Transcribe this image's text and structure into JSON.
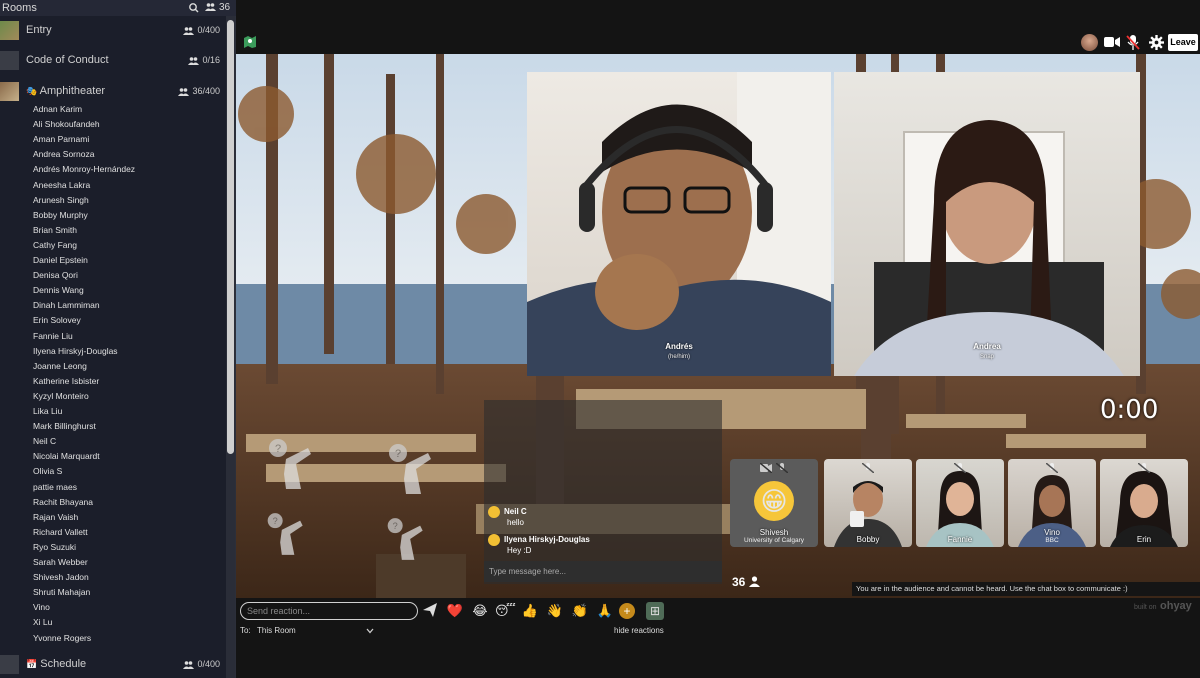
{
  "sidebar": {
    "header_title": "Rooms",
    "header_count": "36",
    "rooms": [
      {
        "name": "Entry",
        "occupancy": "0/400"
      },
      {
        "name": "Code of Conduct",
        "occupancy": "0/16"
      },
      {
        "name": "Amphitheater",
        "occupancy": "36/400"
      }
    ],
    "attendees": [
      "Adnan Karim",
      "Ali Shokoufandeh",
      "Aman Parnami",
      "Andrea Sornoza",
      "Andrés Monroy-Hernández",
      "Aneesha Lakra",
      "Arunesh Singh",
      "Bobby Murphy",
      "Brian Smith",
      "Cathy Fang",
      "Daniel Epstein",
      "Denisa Qori",
      "Dennis Wang",
      "Dinah Lammiman",
      "Erin Solovey",
      "Fannie Liu",
      "Ilyena Hirskyj-Douglas",
      "Joanne Leong",
      "Katherine Isbister",
      "Kyzyl Monteiro",
      "Lika Liu",
      "Mark Billinghurst",
      "Neil C",
      "Nicolai Marquardt",
      "Olivia S",
      "pattie maes",
      "Rachit Bhayana",
      "Rajan Vaish",
      "Richard Vallett",
      "Ryo Suzuki",
      "Sarah Webber",
      "Shivesh Jadon",
      "Shruti Mahajan",
      "Vino",
      "Xi Lu",
      "Yvonne Rogers"
    ],
    "schedule_room": {
      "name": "Schedule",
      "occupancy": "0/400"
    }
  },
  "topbar": {
    "leave_label": "Leave"
  },
  "speakers": [
    {
      "name": "Andrés",
      "subtitle": "(he/him)"
    },
    {
      "name": "Andrea",
      "subtitle": "Snap"
    }
  ],
  "timer": "0:00",
  "audience_tiles": [
    {
      "name": "Shivesh",
      "subtitle": "University of Calgary"
    },
    {
      "name": "Bobby",
      "subtitle": ""
    },
    {
      "name": "Fannie",
      "subtitle": ""
    },
    {
      "name": "Vino",
      "subtitle": "BBC"
    },
    {
      "name": "Erin",
      "subtitle": ""
    }
  ],
  "chat": {
    "messages": [
      {
        "author": "Neil C",
        "text": "hello"
      },
      {
        "author": "Ilyena Hirskyj-Douglas",
        "text": "Hey :D"
      }
    ],
    "input_placeholder": "Type message here..."
  },
  "participant_count": "36",
  "audience_note": "You are in the audience and cannot be heard. Use the chat box to communicate :)",
  "bottombar": {
    "reaction_placeholder": "Send reaction...",
    "to_label": "To:",
    "to_value": "This Room",
    "hide_reactions": "hide reactions",
    "built_on": "built on",
    "brand": "ohyay"
  },
  "reactions": [
    "send-icon",
    "heart",
    "joy",
    "sleepy",
    "thumbs-up",
    "wave",
    "clap",
    "pray",
    "plus"
  ]
}
